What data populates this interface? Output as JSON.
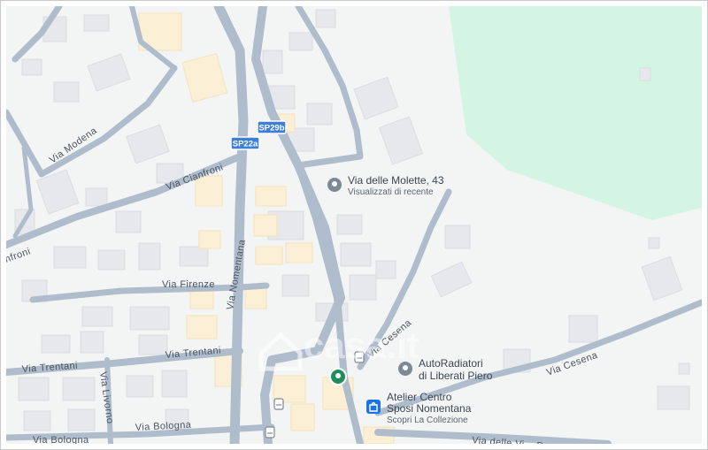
{
  "map": {
    "colors": {
      "background": "#f3f4f4",
      "park": "#d4f5e4",
      "road": "#aebccc",
      "building": "#e7e9ec",
      "building_edge": "#d9dde2",
      "highlight_building": "#fbefd6",
      "route_shield": "#3d7fd6",
      "poi_gray": "#7d8a94",
      "poi_green": "#1e8e5a",
      "shop_blue": "#1a73e8"
    },
    "road_labels": {
      "via_modena": "Via Modena",
      "via_cianfroni": "Via Cianfroni",
      "via_cianfroni_edge": "nfroni",
      "via_firenze": "Via Firenze",
      "via_nomentana": "Via Nomentana",
      "via_trentani": "Via Trentani",
      "via_trentani_2": "Via Trentani",
      "via_livorno": "Via Livorno",
      "via_bologna": "Via Bologna",
      "via_bologna_2": "Via Bologna",
      "via_cesena": "Via Cesena",
      "via_cesena_2": "Via Cesena",
      "via_delle_bottom": "Via delle Vi... Po..."
    },
    "route_shields": {
      "sp29b": "SP29b",
      "sp22a": "SP22a"
    },
    "pois": {
      "recent_place": {
        "title": "Via delle Molette, 43",
        "subtitle": "Visualizzati di recente",
        "icon": "pin-icon"
      },
      "auto_radiatori": {
        "line1": "AutoRadiatori",
        "line2": "di Liberati Piero",
        "icon": "pin-icon"
      },
      "atelier": {
        "line1": "Atelier Centro",
        "line2": "Sposi Nomentana",
        "subtitle": "Scopri La Collezione",
        "icon": "shopping-bag-icon"
      },
      "green_marker": {
        "icon": "pin-icon"
      }
    },
    "watermark": {
      "text": "casa.it",
      "icon": "house-icon"
    }
  }
}
